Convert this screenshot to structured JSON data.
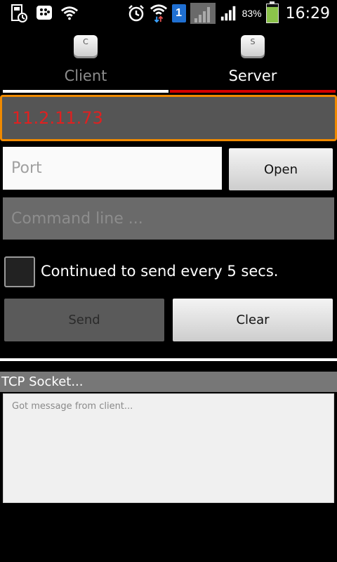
{
  "status_bar": {
    "sim_badge": "1",
    "battery_percent": "83%",
    "battery_level": 0.83,
    "time": "16:29",
    "icons": [
      "storage-icon",
      "bbm-icon",
      "wifi-icon",
      "alarm-icon",
      "wifi-data-icon",
      "sim-badge",
      "signal-gray-icon",
      "signal-icon",
      "battery-icon"
    ]
  },
  "tabs": [
    {
      "key_letter": "C",
      "label": "Client",
      "active": false
    },
    {
      "key_letter": "S",
      "label": "Server",
      "active": true
    }
  ],
  "ip_field": {
    "value": "11.2.11.73"
  },
  "port_field": {
    "value": "",
    "placeholder": "Port"
  },
  "open_button": {
    "label": "Open"
  },
  "command_field": {
    "value": "",
    "placeholder": "Command line ..."
  },
  "repeat_checkbox": {
    "checked": false,
    "label": "Continued to send every 5 secs."
  },
  "send_button": {
    "label": "Send",
    "enabled": false
  },
  "clear_button": {
    "label": "Clear"
  },
  "section": {
    "title": "TCP Socket..."
  },
  "message_area": {
    "text": "Got message from client..."
  },
  "colors": {
    "accent_red": "#d40000",
    "focus_orange": "#f08a00",
    "ip_text": "#e02020",
    "background": "#000000"
  }
}
